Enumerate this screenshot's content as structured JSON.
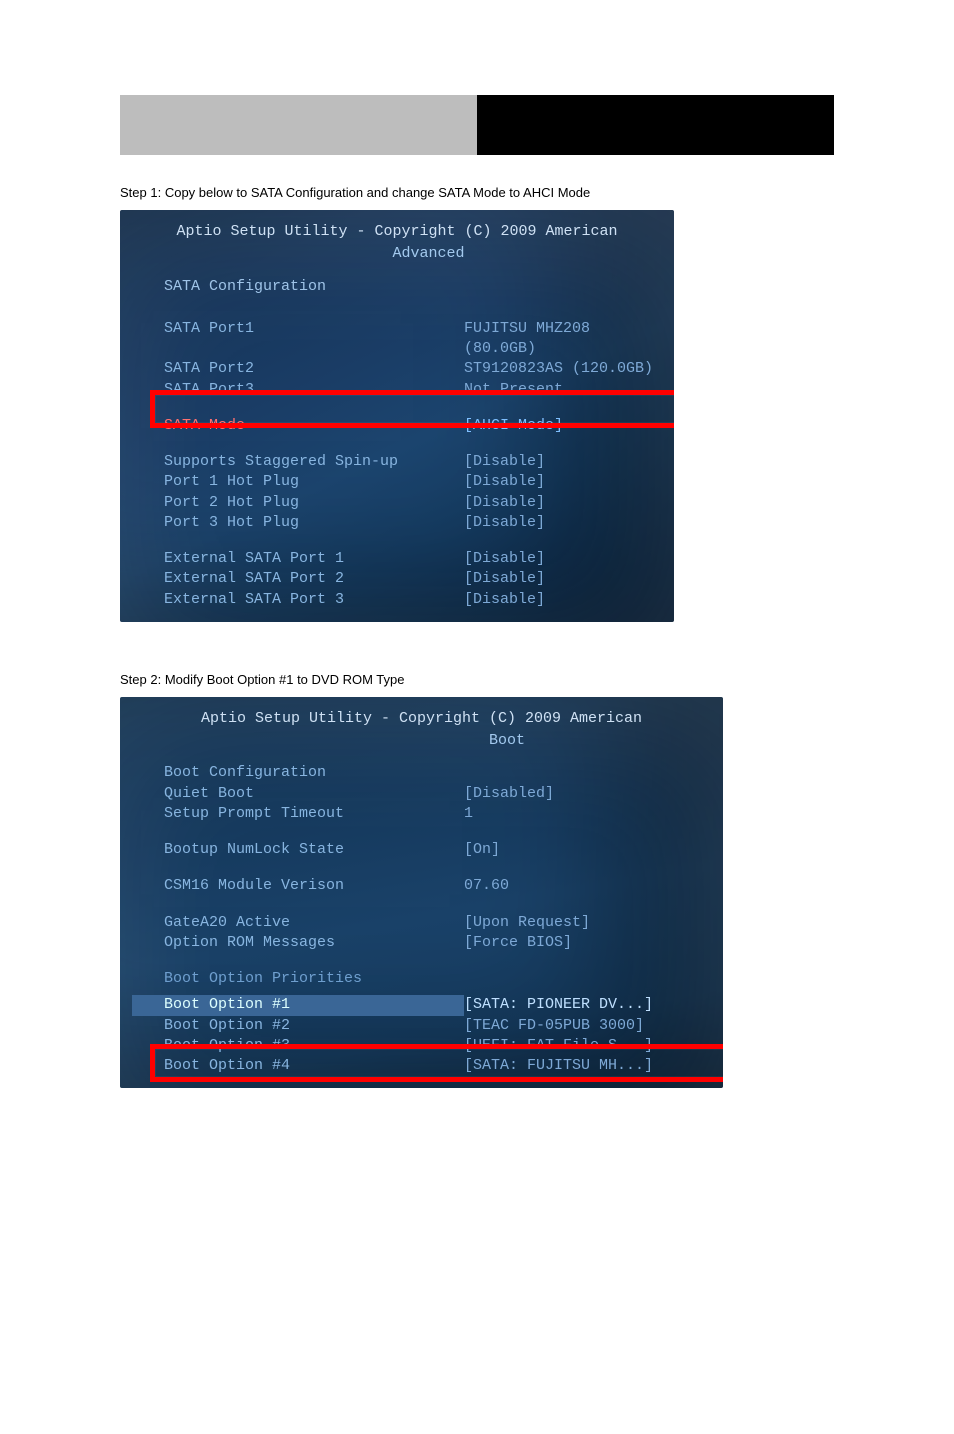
{
  "doc": {
    "product": "",
    "heading": "",
    "step1_prefix": "Step 1:",
    "step1_text": "Copy below to SATA Configuration and change SATA Mode to AHCI Mode",
    "step2_prefix": "Step 2:",
    "step2_text": "Modify Boot Option #1 to DVD ROM Type"
  },
  "bios1": {
    "title": "Aptio Setup Utility - Copyright (C) 2009 American",
    "tab_active": "Advanced",
    "section_header": "SATA Configuration",
    "rows_ports": [
      {
        "label": "SATA Port1",
        "value": "FUJITSU MHZ208 (80.0GB)"
      },
      {
        "label": "SATA Port2",
        "value": "ST9120823AS   (120.0GB)"
      },
      {
        "label": "SATA Port3",
        "value": "Not Present"
      }
    ],
    "sata_mode_label": "SATA Mode",
    "sata_mode_value": "[AHCI Mode]",
    "rows_opts": [
      {
        "label": "Supports Staggered Spin-up",
        "value": "[Disable]"
      },
      {
        "label": "Port 1 Hot Plug",
        "value": "[Disable]"
      },
      {
        "label": "Port 2 Hot Plug",
        "value": "[Disable]"
      },
      {
        "label": "Port 3 Hot Plug",
        "value": "[Disable]"
      }
    ],
    "rows_ext": [
      {
        "label": "External SATA Port 1",
        "value": "[Disable]"
      },
      {
        "label": "External SATA Port 2",
        "value": "[Disable]"
      },
      {
        "label": "External SATA Port 3",
        "value": "[Disable]"
      }
    ]
  },
  "bios2": {
    "title": "Aptio Setup Utility - Copyright (C) 2009 American",
    "tab_active": "Boot",
    "rows_top": [
      {
        "label": "Boot Configuration",
        "value": ""
      },
      {
        "label": "Quiet Boot",
        "value": "[Disabled]"
      },
      {
        "label": "Setup Prompt Timeout",
        "value": "1"
      }
    ],
    "rows_numlock": [
      {
        "label": "Bootup NumLock State",
        "value": "[On]"
      }
    ],
    "rows_csm": [
      {
        "label": "CSM16 Module Verison",
        "value": "07.60"
      }
    ],
    "rows_gate": [
      {
        "label": "GateA20 Active",
        "value": "[Upon Request]"
      },
      {
        "label": "Option ROM Messages",
        "value": "[Force BIOS]"
      }
    ],
    "rows_prio_header": "Boot Option Priorities",
    "rows_prio": [
      {
        "label": "Boot Option #1",
        "value": "[SATA: PIONEER DV...]"
      },
      {
        "label": "Boot Option #2",
        "value": "[TEAC FD-05PUB 3000]"
      },
      {
        "label": "Boot Option #3",
        "value": "[UEFI: FAT File S...]"
      },
      {
        "label": "Boot Option #4",
        "value": "[SATA: FUJITSU MH...]"
      }
    ]
  }
}
